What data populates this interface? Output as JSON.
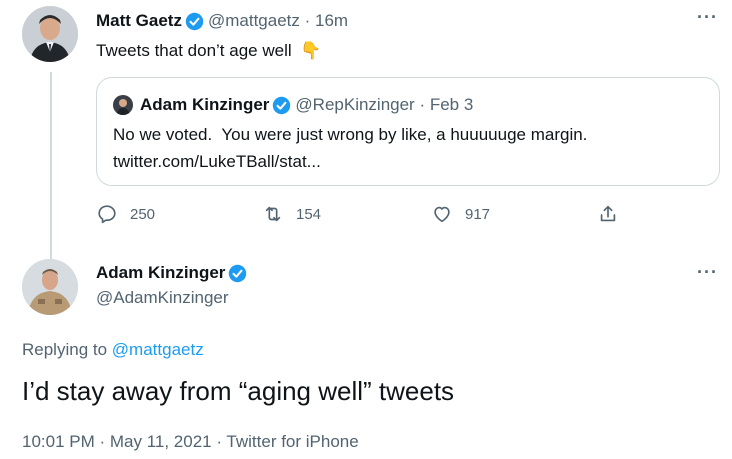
{
  "tweet": {
    "name": "Matt Gaetz",
    "handle": "@mattgaetz",
    "time": "16m",
    "text": "Tweets that don’t age well",
    "emoji": "👇",
    "quote": {
      "name": "Adam Kinzinger",
      "handle": "@RepKinzinger",
      "date": "Feb 3",
      "text": "No we voted.  You were just wrong by like, a huuuuuge margin.",
      "link": "twitter.com/LukeTBall/stat..."
    },
    "actions": {
      "replies": "250",
      "retweets": "154",
      "likes": "917"
    }
  },
  "reply": {
    "name": "Adam Kinzinger",
    "handle": "@AdamKinzinger",
    "replying_prefix": "Replying to",
    "replying_to": "@mattgaetz",
    "text": "I’d stay away from “aging well” tweets",
    "timestamp": "10:01 PM · May 11, 2021 · Twitter for iPhone"
  },
  "icons": {
    "verified": "verified-badge-icon",
    "more": "more-icon",
    "reply": "reply-icon",
    "retweet": "retweet-icon",
    "like": "like-icon",
    "share": "share-icon"
  },
  "colors": {
    "accent": "#1d9bf0",
    "text": "#0f1419",
    "secondary": "#536471",
    "border": "#cfd9de"
  }
}
